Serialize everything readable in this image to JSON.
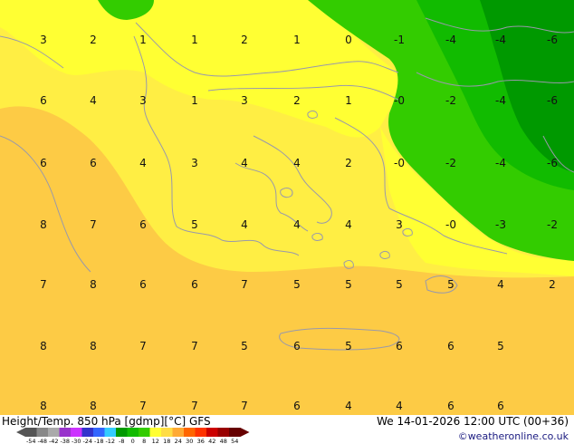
{
  "title": "Height/Temp. 850 hPa [gdmp][°C] GFS",
  "datetime": "We 14-01-2026 12:00 UTC (00+36)",
  "credit": "©weatheronline.co.uk",
  "colors": {
    "yellow_light": "#FFFF33",
    "yellow": "#FFEE44",
    "yellow_orange": "#FFDD44",
    "orange_light": "#FDCB45",
    "green_light": "#33CC00",
    "green": "#11BB00",
    "green_dark": "#009900",
    "border": "#9999AA"
  },
  "scale": {
    "labels": [
      "-54",
      "-48",
      "-42",
      "-38",
      "-30",
      "-24",
      "-18",
      "-12",
      "-8",
      "0",
      "8",
      "12",
      "18",
      "24",
      "30",
      "36",
      "42",
      "48",
      "54"
    ],
    "colors": [
      "#555555",
      "#888888",
      "#aaaaaa",
      "#9933cc",
      "#cc33ff",
      "#3333cc",
      "#3366ff",
      "#33ccff",
      "#009900",
      "#11bb00",
      "#33cc00",
      "#ffff33",
      "#ffdd44",
      "#ffaa33",
      "#ff6600",
      "#ff3300",
      "#cc0000",
      "#990000",
      "#660000"
    ]
  },
  "values": [
    {
      "text": "3",
      "col": 0,
      "row": 0
    },
    {
      "text": "2",
      "col": 1,
      "row": 0
    },
    {
      "text": "1",
      "col": 2,
      "row": 0
    },
    {
      "text": "1",
      "col": 3,
      "row": 0
    },
    {
      "text": "2",
      "col": 4,
      "row": 0
    },
    {
      "text": "1",
      "col": 5,
      "row": 0
    },
    {
      "text": "0",
      "col": 6,
      "row": 0
    },
    {
      "text": "-1",
      "col": 7,
      "row": 0
    },
    {
      "text": "-4",
      "col": 8,
      "row": 0
    },
    {
      "text": "-4",
      "col": 9,
      "row": 0
    },
    {
      "text": "-6",
      "col": 10,
      "row": 0
    },
    {
      "text": "6",
      "col": 0,
      "row": 1
    },
    {
      "text": "4",
      "col": 1,
      "row": 1
    },
    {
      "text": "3",
      "col": 2,
      "row": 1
    },
    {
      "text": "1",
      "col": 3,
      "row": 1
    },
    {
      "text": "3",
      "col": 4,
      "row": 1
    },
    {
      "text": "2",
      "col": 5,
      "row": 1
    },
    {
      "text": "1",
      "col": 6,
      "row": 1
    },
    {
      "text": "-0",
      "col": 7,
      "row": 1
    },
    {
      "text": "-2",
      "col": 8,
      "row": 1
    },
    {
      "text": "-4",
      "col": 9,
      "row": 1
    },
    {
      "text": "-6",
      "col": 10,
      "row": 1
    },
    {
      "text": "6",
      "col": 0,
      "row": 2
    },
    {
      "text": "6",
      "col": 1,
      "row": 2
    },
    {
      "text": "4",
      "col": 2,
      "row": 2
    },
    {
      "text": "3",
      "col": 3,
      "row": 2
    },
    {
      "text": "4",
      "col": 4,
      "row": 2
    },
    {
      "text": "4",
      "col": 5,
      "row": 2
    },
    {
      "text": "2",
      "col": 6,
      "row": 2
    },
    {
      "text": "-0",
      "col": 7,
      "row": 2
    },
    {
      "text": "-2",
      "col": 8,
      "row": 2
    },
    {
      "text": "-4",
      "col": 9,
      "row": 2
    },
    {
      "text": "-6",
      "col": 10,
      "row": 2
    },
    {
      "text": "8",
      "col": 0,
      "row": 3
    },
    {
      "text": "7",
      "col": 1,
      "row": 3
    },
    {
      "text": "6",
      "col": 2,
      "row": 3
    },
    {
      "text": "5",
      "col": 3,
      "row": 3
    },
    {
      "text": "4",
      "col": 4,
      "row": 3
    },
    {
      "text": "4",
      "col": 5,
      "row": 3
    },
    {
      "text": "4",
      "col": 6,
      "row": 3
    },
    {
      "text": "3",
      "col": 7,
      "row": 3
    },
    {
      "text": "-0",
      "col": 8,
      "row": 3
    },
    {
      "text": "-3",
      "col": 9,
      "row": 3
    },
    {
      "text": "-2",
      "col": 10,
      "row": 3
    },
    {
      "text": "7",
      "col": 0,
      "row": 4
    },
    {
      "text": "8",
      "col": 1,
      "row": 4
    },
    {
      "text": "6",
      "col": 2,
      "row": 4
    },
    {
      "text": "6",
      "col": 3,
      "row": 4
    },
    {
      "text": "7",
      "col": 4,
      "row": 4
    },
    {
      "text": "5",
      "col": 5,
      "row": 4
    },
    {
      "text": "5",
      "col": 6,
      "row": 4
    },
    {
      "text": "5",
      "col": 7,
      "row": 4
    },
    {
      "text": "5",
      "col": 8,
      "row": 4
    },
    {
      "text": "4",
      "col": 9,
      "row": 4
    },
    {
      "text": "2",
      "col": 10,
      "row": 4
    },
    {
      "text": "8",
      "col": 0,
      "row": 5
    },
    {
      "text": "8",
      "col": 1,
      "row": 5
    },
    {
      "text": "7",
      "col": 2,
      "row": 5
    },
    {
      "text": "7",
      "col": 3,
      "row": 5
    },
    {
      "text": "5",
      "col": 4,
      "row": 5
    },
    {
      "text": "6",
      "col": 5,
      "row": 5
    },
    {
      "text": "5",
      "col": 6,
      "row": 5
    },
    {
      "text": "6",
      "col": 7,
      "row": 5
    },
    {
      "text": "6",
      "col": 8,
      "row": 5
    },
    {
      "text": "5",
      "col": 9,
      "row": 5
    },
    {
      "text": "8",
      "col": 0,
      "row": 6
    },
    {
      "text": "8",
      "col": 1,
      "row": 6
    },
    {
      "text": "7",
      "col": 2,
      "row": 6
    },
    {
      "text": "7",
      "col": 3,
      "row": 6
    },
    {
      "text": "7",
      "col": 4,
      "row": 6
    },
    {
      "text": "6",
      "col": 5,
      "row": 6
    },
    {
      "text": "4",
      "col": 6,
      "row": 6
    },
    {
      "text": "4",
      "col": 7,
      "row": 6
    },
    {
      "text": "6",
      "col": 8,
      "row": 6
    },
    {
      "text": "6",
      "col": 9,
      "row": 6
    }
  ]
}
